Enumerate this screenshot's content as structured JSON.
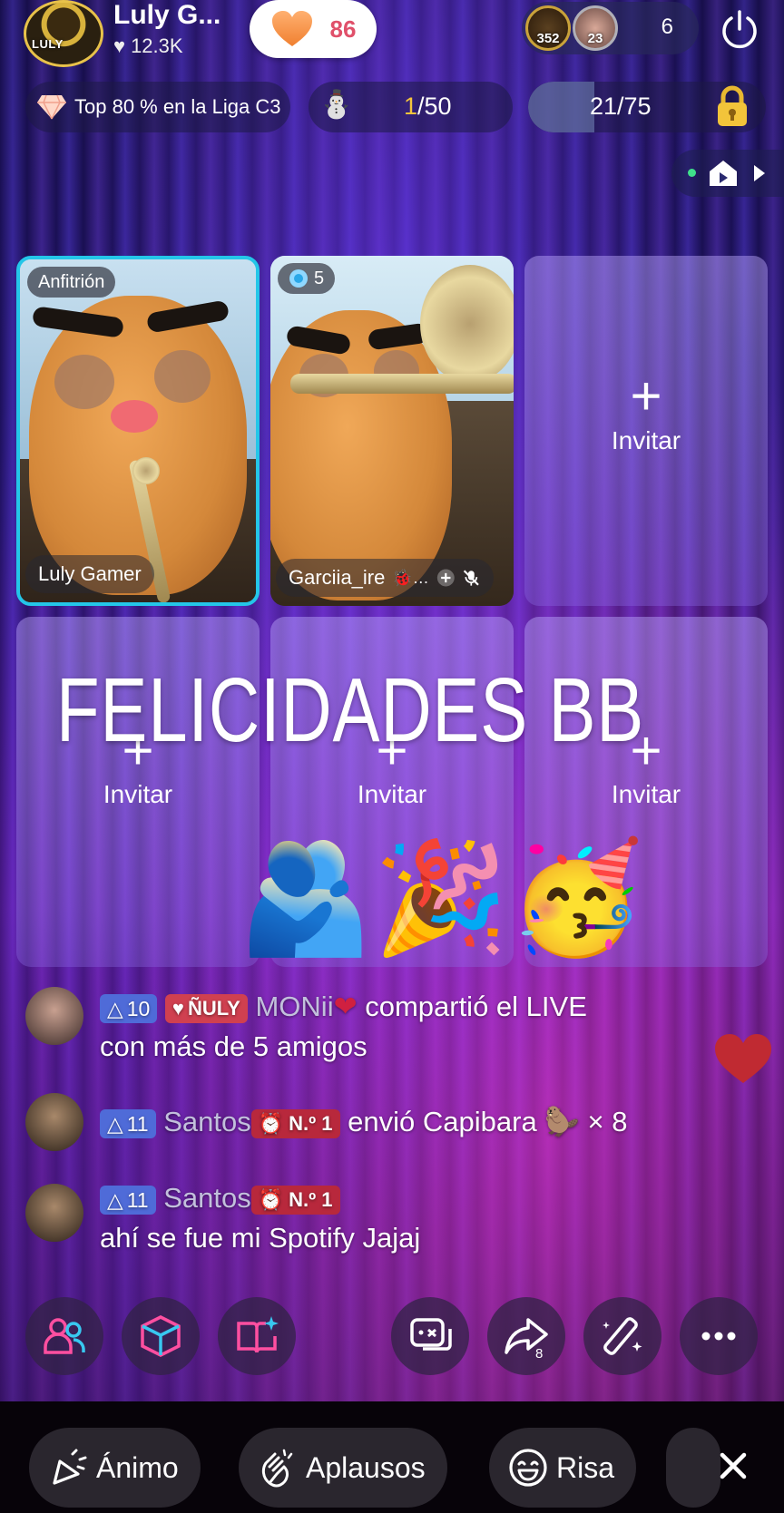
{
  "host": {
    "name": "Luly G...",
    "likes": "12.3K",
    "avatar_text": "LULY"
  },
  "heart_counter": "86",
  "viewers": {
    "avatars": [
      {
        "label": "352",
        "color": "#c9a23a"
      },
      {
        "label": "23",
        "color": "#b0b0b8"
      }
    ],
    "count": "6"
  },
  "league": {
    "text": "Top 80 % en la Liga C3"
  },
  "ranking": {
    "current": "1",
    "total": "/50"
  },
  "progress": {
    "text": "21/75",
    "fraction": 0.28
  },
  "slots": [
    {
      "tag": "Anfitrión",
      "name": "Luly Gamer"
    },
    {
      "tag_count": "5",
      "name": "Garciia_ire"
    }
  ],
  "invite_label": "Invitar",
  "invite_plus": "+",
  "overlay": {
    "text": "FELICIDADES BB",
    "emojis": "🫂🎉🥳"
  },
  "chat": [
    {
      "level": "10",
      "fan": "ÑULY",
      "user": "MONii",
      "text": "compartió el LIVE",
      "text2": "con más de 5 amigos"
    },
    {
      "level": "11",
      "user": "Santos",
      "badge": "N.º 1",
      "text": "envió Capibara",
      "gift": "🦫",
      "count": "× 8"
    },
    {
      "level": "11",
      "user": "Santos",
      "badge": "N.º 1",
      "text": "ahí se fue mi Spotify Jajaj"
    }
  ],
  "share_count": "8",
  "reactions": [
    {
      "label": "Ánimo"
    },
    {
      "label": "Aplausos"
    },
    {
      "label": "Risa"
    }
  ],
  "colors": {
    "accent_cyan": "#24c6e8",
    "heart": "#e0506a",
    "level_badge": "#4f6bd8",
    "gold": "#f4c43c"
  }
}
